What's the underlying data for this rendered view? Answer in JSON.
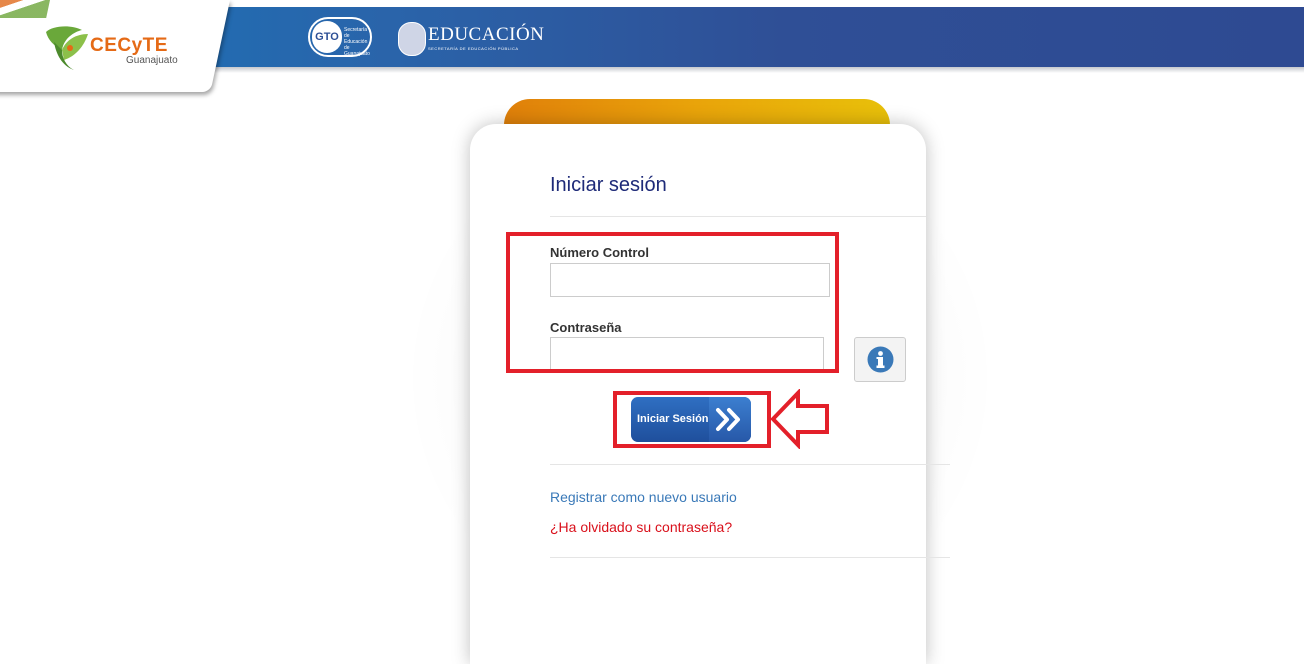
{
  "header": {
    "brand_name": "CECyTE",
    "brand_subtitle": "Guanajuato",
    "gto_logo_text": "GTO",
    "gto_logo_small": "Secretaría de Educación de Guanajuato",
    "sep_logo_text": "EDUCACIÓN",
    "sep_logo_small": "SECRETARÍA DE EDUCACIÓN PÚBLICA"
  },
  "login": {
    "title": "Iniciar sesión",
    "user_label": "Número Control",
    "user_value": "",
    "password_label": "Contraseña",
    "password_value": "",
    "info_icon": "info-circle-icon",
    "submit_label": "Iniciar Sesión",
    "submit_icon": "double-chevron-right-icon",
    "register_link": "Registrar como nuevo usuario",
    "forgot_link": "¿Ha olvidado su contraseña?"
  },
  "colors": {
    "header_blue": "#2e4a92",
    "title_color": "#1e2a78",
    "register_link": "#3a79b8",
    "forgot_link": "#d9101b",
    "annotation_red": "#e3202a",
    "card_accent": "#e9a40a"
  }
}
